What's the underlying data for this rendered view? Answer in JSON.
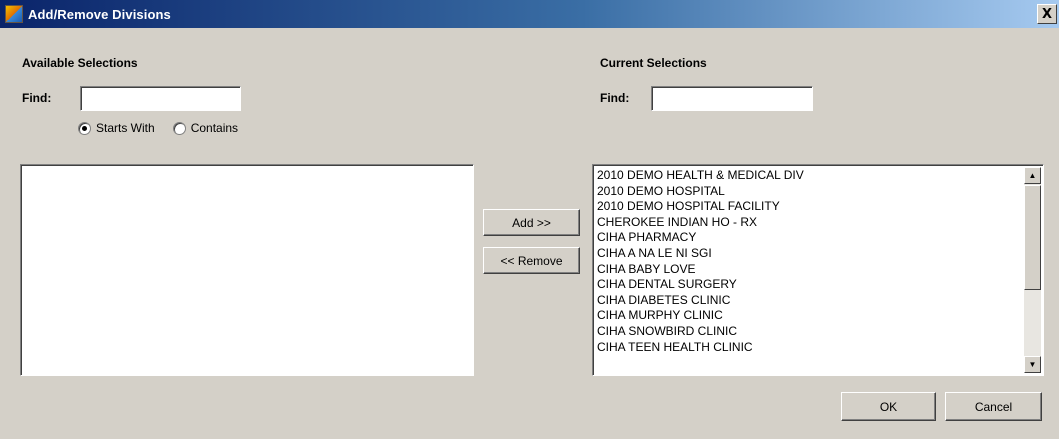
{
  "window": {
    "title": "Add/Remove Divisions",
    "close_glyph": "X",
    "app_icon": "app-icon"
  },
  "available": {
    "heading": "Available Selections",
    "find_label": "Find:",
    "find_value": "",
    "radio_starts_with": "Starts With",
    "radio_contains": "Contains",
    "selected_mode": "starts_with",
    "items": []
  },
  "current": {
    "heading": "Current Selections",
    "find_label": "Find:",
    "find_value": "",
    "items": [
      "2010 DEMO HEALTH & MEDICAL DIV",
      "2010 DEMO HOSPITAL",
      "2010 DEMO HOSPITAL FACILITY",
      "CHEROKEE INDIAN HO - RX",
      "CIHA  PHARMACY",
      "CIHA A NA LE NI SGI",
      "CIHA BABY LOVE",
      "CIHA DENTAL SURGERY",
      "CIHA DIABETES CLINIC",
      "CIHA MURPHY CLINIC",
      "CIHA SNOWBIRD CLINIC",
      "CIHA TEEN HEALTH CLINIC"
    ]
  },
  "buttons": {
    "add": "Add >>",
    "remove": "<< Remove",
    "ok": "OK",
    "cancel": "Cancel"
  },
  "scrollbar": {
    "up_glyph": "▲",
    "down_glyph": "▼"
  }
}
